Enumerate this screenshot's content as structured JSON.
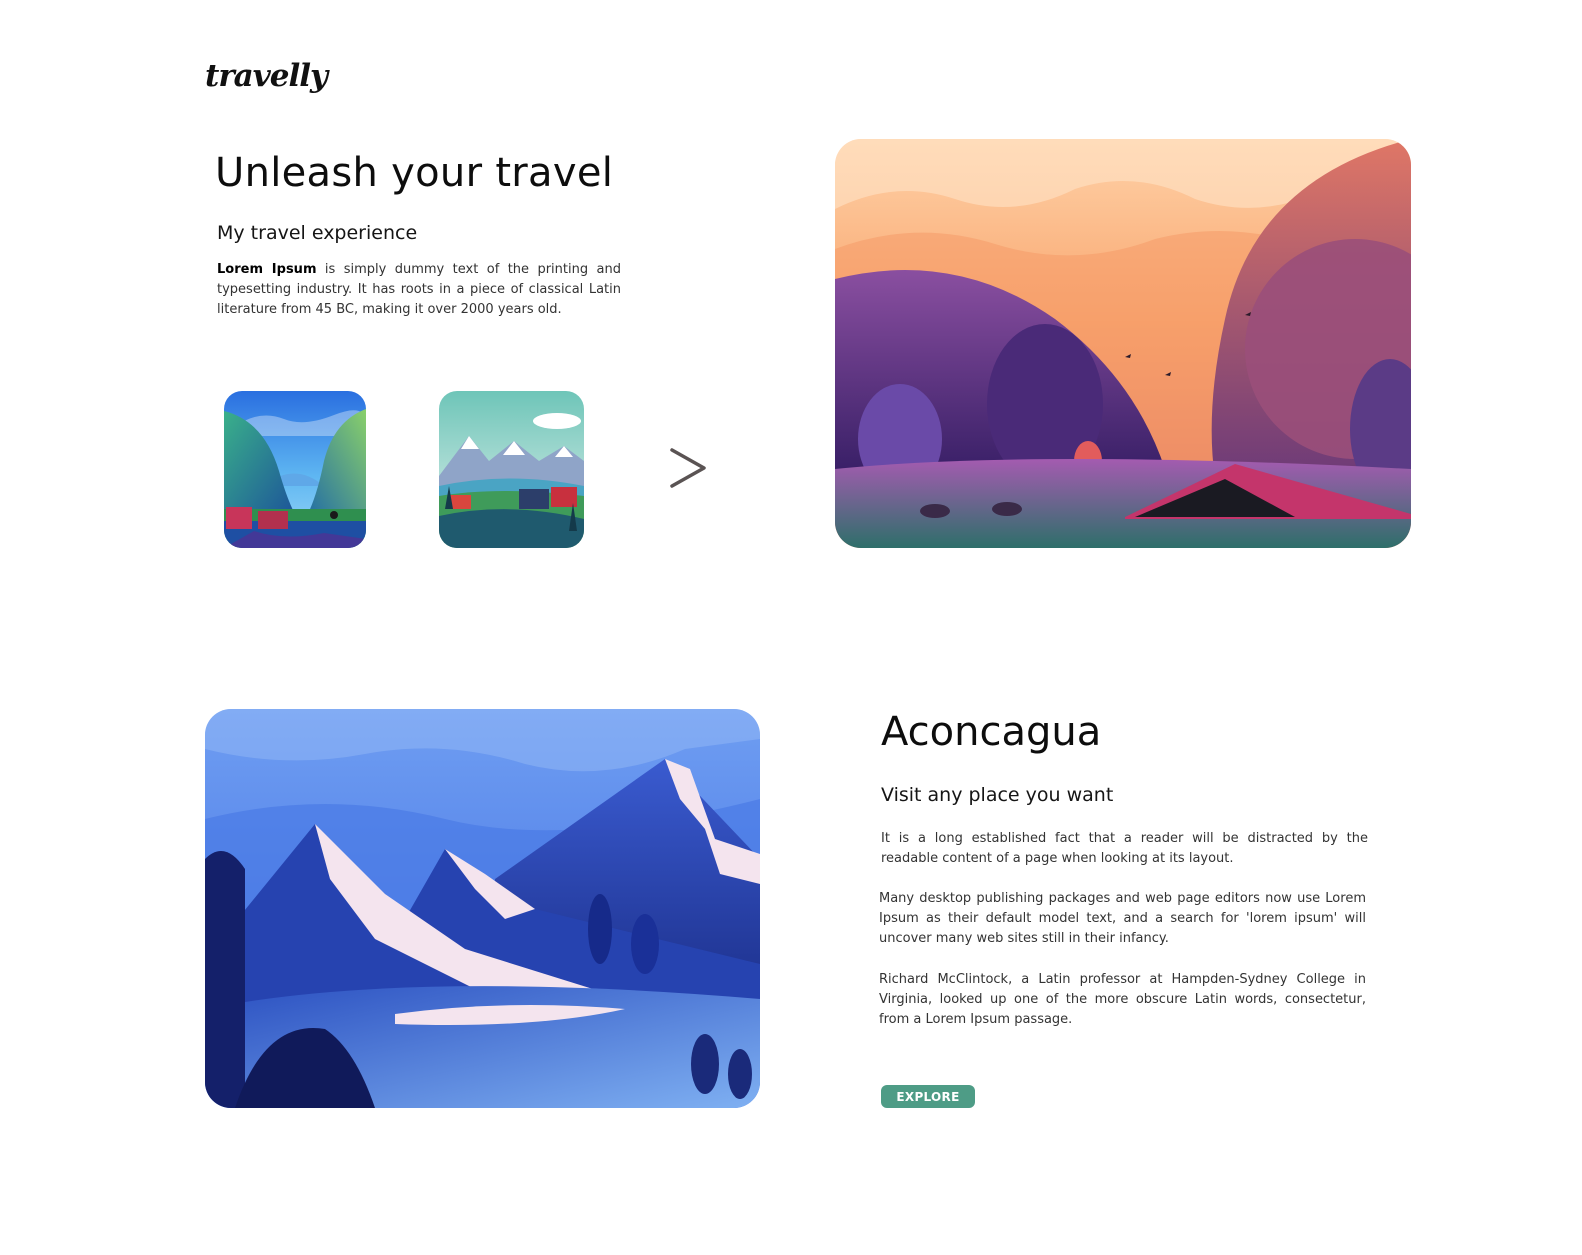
{
  "brand": {
    "logo_text": "travelly"
  },
  "hero": {
    "title": "Unleash your travel",
    "subtitle": "My travel experience",
    "body_bold": "Lorem Ipsum",
    "body_rest": " is simply dummy text of the printing and typesetting industry. It has roots in a piece of classical Latin literature from 45 BC, making it over 2000 years old.",
    "thumbnails": [
      {
        "icon": "blue-valley-landscape-image"
      },
      {
        "icon": "snowy-mountain-village-image"
      }
    ],
    "next_icon": "chevron-right-icon",
    "main_image": "sunset-forest-valley-illustration"
  },
  "feature": {
    "image": "blue-snowy-mountains-illustration",
    "title": "Aconcagua",
    "subtitle": "Visit any place you want",
    "paragraphs": [
      "It is a long established fact that a reader will be distracted by the readable content of a page when looking at its layout.",
      "Many desktop publishing packages and web page editors now use Lorem Ipsum as their default model text, and a search for 'lorem ipsum' will uncover many web sites still in their infancy.",
      "Richard McClintock, a Latin professor at Hampden-Sydney College in Virginia, looked up one of the more obscure Latin words, consectetur, from a Lorem Ipsum passage."
    ],
    "explore_label": "EXPLORE"
  },
  "colors": {
    "accent": "#4e9c86",
    "text": "#111111"
  }
}
